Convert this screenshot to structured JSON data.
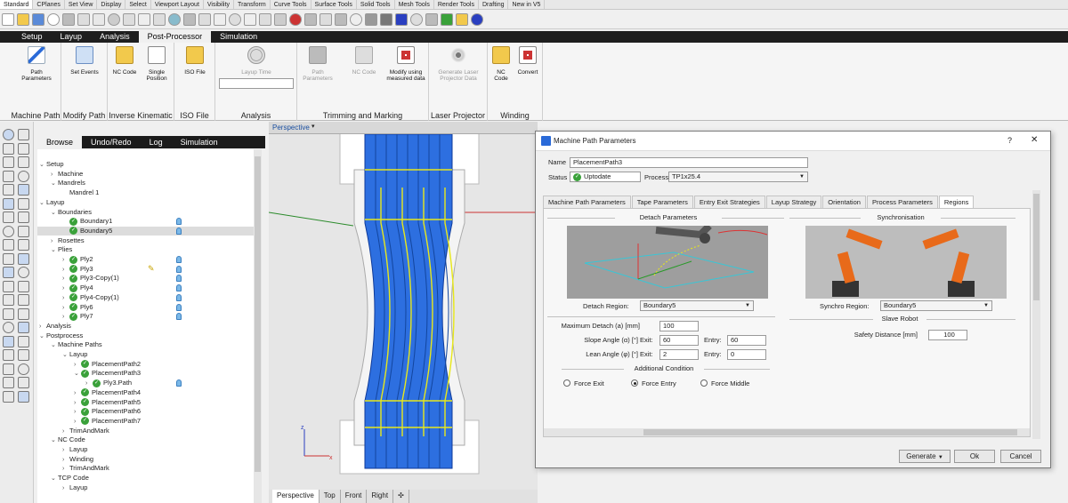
{
  "toolbar_tabs": [
    "Standard",
    "CPlanes",
    "Set View",
    "Display",
    "Select",
    "Viewport Layout",
    "Visibility",
    "Transform",
    "Curve Tools",
    "Surface Tools",
    "Solid Tools",
    "Mesh Tools",
    "Render Tools",
    "Drafting",
    "New in V5"
  ],
  "ribbon": {
    "tabs": [
      "Setup",
      "Layup",
      "Analysis",
      "Post-Processor",
      "Simulation"
    ],
    "active_tab": "Post-Processor",
    "groups": {
      "machine_path": {
        "label": "Machine Path",
        "button": "Path Parameters"
      },
      "modify_path": {
        "label": "Modify Path",
        "button": "Set Events"
      },
      "inverse_kinematics": {
        "label": "Inverse Kinematic",
        "buttons": [
          "NC Code",
          "Single Position"
        ]
      },
      "iso_file": {
        "label": "ISO File",
        "button": "ISO File"
      },
      "analysis": {
        "label": "Analysis",
        "button": "Layup Time"
      },
      "trimming": {
        "label": "Trimming and Marking",
        "buttons": [
          "Path Parameters",
          "NC Code",
          "Modify using measured data"
        ]
      },
      "laser": {
        "label": "Laser Projector",
        "button": "Generate Laser Projector Data"
      },
      "winding": {
        "label": "Winding",
        "buttons": [
          "NC Code",
          "Convert"
        ]
      }
    }
  },
  "browser": {
    "tabs": [
      "Browse",
      "Undo/Redo",
      "Log",
      "Simulation"
    ],
    "tree": [
      {
        "text": "Setup",
        "level": 0,
        "arrow": "v"
      },
      {
        "text": "Machine",
        "level": 1,
        "arrow": ">"
      },
      {
        "text": "Mandrels",
        "level": 1,
        "arrow": "v"
      },
      {
        "text": "Mandrel 1",
        "level": 2,
        "arrow": ""
      },
      {
        "text": "Layup",
        "level": 0,
        "arrow": "v"
      },
      {
        "text": "Boundaries",
        "level": 1,
        "arrow": "v"
      },
      {
        "text": "Boundary1",
        "level": 2,
        "arrow": "",
        "check": true,
        "bulb": true
      },
      {
        "text": "Boundary5",
        "level": 2,
        "arrow": "",
        "check": true,
        "bulb": true,
        "selected": true
      },
      {
        "text": "Rosettes",
        "level": 1,
        "arrow": ">"
      },
      {
        "text": "Plies",
        "level": 1,
        "arrow": "v"
      },
      {
        "text": "Ply2",
        "level": 2,
        "arrow": ">",
        "check": true,
        "bulb": true
      },
      {
        "text": "Ply3",
        "level": 2,
        "arrow": ">",
        "check": true,
        "bulb": true,
        "pencil": true
      },
      {
        "text": "Ply3-Copy(1)",
        "level": 2,
        "arrow": ">",
        "check": true,
        "bulb": true
      },
      {
        "text": "Ply4",
        "level": 2,
        "arrow": ">",
        "check": true,
        "bulb": true
      },
      {
        "text": "Ply4-Copy(1)",
        "level": 2,
        "arrow": ">",
        "check": true,
        "bulb": true
      },
      {
        "text": "Ply6",
        "level": 2,
        "arrow": ">",
        "check": true,
        "bulb": true
      },
      {
        "text": "Ply7",
        "level": 2,
        "arrow": ">",
        "check": true,
        "bulb": true
      },
      {
        "text": "Analysis",
        "level": 0,
        "arrow": ">"
      },
      {
        "text": "Postprocess",
        "level": 0,
        "arrow": "v"
      },
      {
        "text": "Machine Paths",
        "level": 1,
        "arrow": "v"
      },
      {
        "text": "Layup",
        "level": 2,
        "arrow": "v"
      },
      {
        "text": "PlacementPath2",
        "level": 3,
        "arrow": ">",
        "check": true
      },
      {
        "text": "PlacementPath3",
        "level": 3,
        "arrow": "v",
        "check": true
      },
      {
        "text": "Ply3.Path",
        "level": 4,
        "arrow": ">",
        "check": true,
        "bulb": true
      },
      {
        "text": "PlacementPath4",
        "level": 3,
        "arrow": ">",
        "check": true
      },
      {
        "text": "PlacementPath5",
        "level": 3,
        "arrow": ">",
        "check": true
      },
      {
        "text": "PlacementPath6",
        "level": 3,
        "arrow": ">",
        "check": true
      },
      {
        "text": "PlacementPath7",
        "level": 3,
        "arrow": ">",
        "check": true
      },
      {
        "text": "TrimAndMark",
        "level": 2,
        "arrow": ">"
      },
      {
        "text": "NC Code",
        "level": 1,
        "arrow": "v"
      },
      {
        "text": "Layup",
        "level": 2,
        "arrow": ">"
      },
      {
        "text": "Winding",
        "level": 2,
        "arrow": ">"
      },
      {
        "text": "TrimAndMark",
        "level": 2,
        "arrow": ">"
      },
      {
        "text": "TCP Code",
        "level": 1,
        "arrow": "v"
      },
      {
        "text": "Layup",
        "level": 2,
        "arrow": ">"
      }
    ]
  },
  "viewport": {
    "title": "Perspective",
    "tabs": [
      "Perspective",
      "Top",
      "Front",
      "Right"
    ],
    "axis_x": "x",
    "axis_z": "z"
  },
  "dialog": {
    "title": "Machine Path Parameters",
    "help": "?",
    "close": "✕",
    "name_label": "Name",
    "name_value": "PlacementPath3",
    "status_label": "Status",
    "status_value": "Uptodate",
    "process_label": "Process",
    "process_value": "TP1x25.4",
    "tabs": [
      "Machine Path Parameters",
      "Tape Parameters",
      "Entry Exit Strategies",
      "Layup Strategy",
      "Orientation",
      "Process Parameters",
      "Regions"
    ],
    "active_tab": "Regions",
    "detach": {
      "heading": "Detach Parameters",
      "region_label": "Detach Region:",
      "region_value": "Boundary5",
      "max_label": "Maximum Detach (a) [mm]",
      "max_value": "100",
      "slope_label": "Slope Angle (α) [°]",
      "slope_exit_label": "Exit:",
      "slope_exit": "60",
      "slope_entry_label": "Entry:",
      "slope_entry": "60",
      "lean_label": "Lean Angle (φ) [°]",
      "lean_exit_label": "Exit:",
      "lean_exit": "2",
      "lean_entry_label": "Entry:",
      "lean_entry": "0",
      "additional": "Additional Condition",
      "radios": [
        "Force Exit",
        "Force Entry",
        "Force Middle"
      ],
      "selected_radio": "Force Entry"
    },
    "sync": {
      "heading": "Synchronisation",
      "region_label": "Synchro Region:",
      "region_value": "Boundary5",
      "slave_heading": "Slave Robot",
      "safety_label": "Safety Distance [mm]",
      "safety_value": "100"
    },
    "buttons": {
      "generate": "Generate",
      "ok": "Ok",
      "cancel": "Cancel"
    }
  },
  "colors": {
    "ribbon_dark": "#1e1e1e",
    "accent_blue": "#1f5fd0",
    "ok_green": "#3aa13a",
    "robot_orange": "#e86a1a"
  }
}
